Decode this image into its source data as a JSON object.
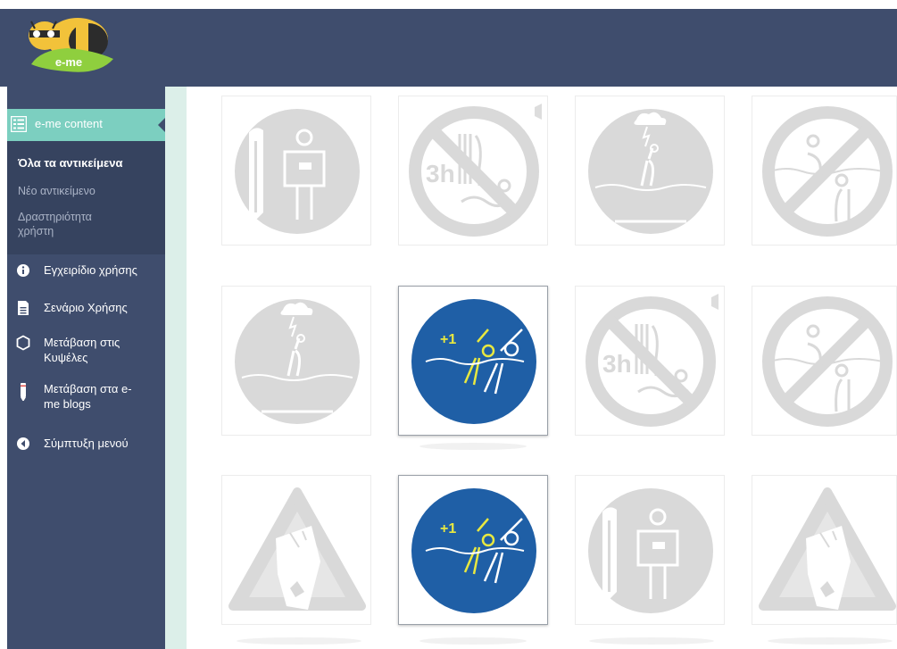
{
  "header": {
    "logo_text": "e-me"
  },
  "sidebar": {
    "active_item": {
      "label": "e-me content",
      "icon": "list-icon"
    },
    "sub_items": [
      {
        "label": "Όλα τα αντικείμενα",
        "selected": true
      },
      {
        "label": "Νέο αντικείμενο",
        "selected": false
      },
      {
        "label_line1": "Δραστηριότητα",
        "label_line2": "χρήστη",
        "selected": false
      }
    ],
    "menu": [
      {
        "line1": "Εγχειρίδιο χρήσης",
        "icon": "info-icon"
      },
      {
        "line1": "Σενάριο Χρήσης",
        "icon": "document-icon"
      },
      {
        "line1": "Μετάβαση στις",
        "line2": "Κυψέλες",
        "icon": "hexagon-icon"
      },
      {
        "line1": "Μετάβαση στα e-",
        "line2": "me blogs",
        "icon": "pencil-icon"
      },
      {
        "line1": "Σύμπτυξη μενού",
        "icon": "collapse-arrow-icon"
      }
    ]
  },
  "content": {
    "tiles": [
      {
        "icon": "lifeguard-tower-icon",
        "selected": false
      },
      {
        "icon": "no-swimming-after-eating-3h-icon",
        "caption": "3h",
        "selected": false
      },
      {
        "icon": "lightning-storm-swimmer-icon",
        "selected": false
      },
      {
        "icon": "no-pushing-in-water-icon",
        "selected": false
      },
      {
        "icon": "lightning-storm-swimmer-icon",
        "selected": false
      },
      {
        "icon": "swim-with-buddy-icon",
        "caption": "+1",
        "selected": true
      },
      {
        "icon": "no-swimming-after-eating-3h-icon",
        "caption": "3h",
        "selected": false
      },
      {
        "icon": "no-pushing-in-water-icon",
        "selected": false
      },
      {
        "icon": "falling-rocks-warning-icon",
        "selected": false
      },
      {
        "icon": "swim-with-buddy-icon",
        "caption": "+1",
        "selected": true
      },
      {
        "icon": "lifeguard-tower-icon",
        "selected": false
      },
      {
        "icon": "falling-rocks-warning-icon",
        "selected": false
      }
    ]
  }
}
